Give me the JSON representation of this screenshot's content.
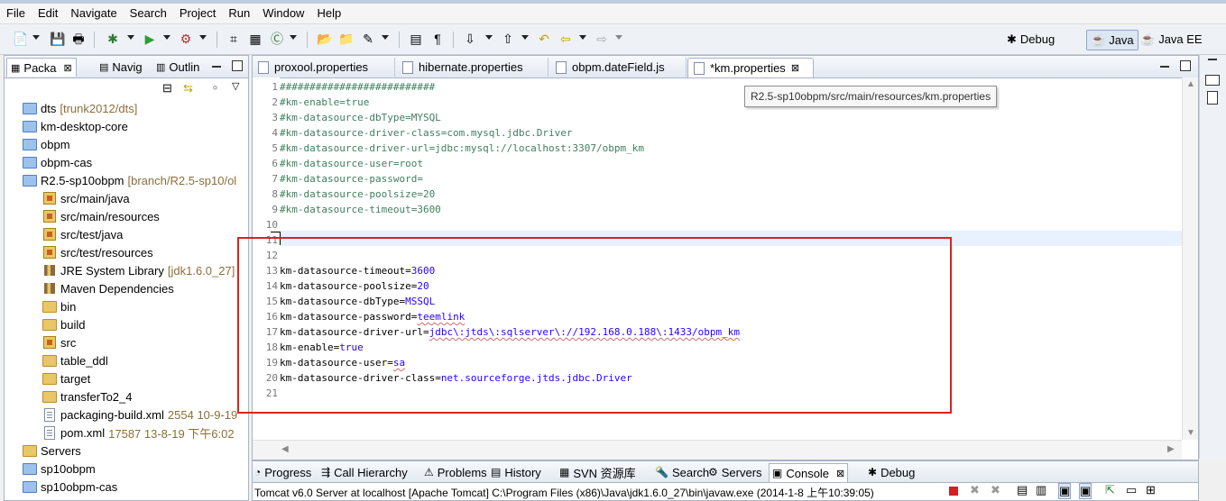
{
  "menu": [
    "File",
    "Edit",
    "Navigate",
    "Search",
    "Project",
    "Run",
    "Window",
    "Help"
  ],
  "perspectives": [
    {
      "label": "Debug",
      "active": false
    },
    {
      "label": "Java",
      "active": true
    },
    {
      "label": "Java EE",
      "active": false
    }
  ],
  "left_panel": {
    "tabs": [
      {
        "label": "Packa",
        "active": true,
        "close": "⊠"
      },
      {
        "label": "Navig",
        "active": false
      },
      {
        "label": "Outlin",
        "active": false
      }
    ],
    "tree": [
      {
        "label": "dts",
        "deco": "[trunk2012/dts]",
        "icon": "folder-blue",
        "indent": 0
      },
      {
        "label": "km-desktop-core",
        "deco": "",
        "icon": "folder-blue",
        "indent": 0
      },
      {
        "label": "obpm",
        "deco": "",
        "icon": "folder-blue",
        "indent": 0
      },
      {
        "label": "obpm-cas",
        "deco": "",
        "icon": "folder-blue",
        "indent": 0
      },
      {
        "label": "R2.5-sp10obpm",
        "deco": "[branch/R2.5-sp10/ol",
        "icon": "folder-blue",
        "indent": 0
      },
      {
        "label": "src/main/java",
        "deco": "",
        "icon": "pkg",
        "indent": 1
      },
      {
        "label": "src/main/resources",
        "deco": "",
        "icon": "pkg",
        "indent": 1
      },
      {
        "label": "src/test/java",
        "deco": "",
        "icon": "pkg",
        "indent": 1
      },
      {
        "label": "src/test/resources",
        "deco": "",
        "icon": "pkg",
        "indent": 1
      },
      {
        "label": "JRE System Library",
        "deco": "[jdk1.6.0_27]",
        "icon": "lib",
        "indent": 1
      },
      {
        "label": "Maven Dependencies",
        "deco": "",
        "icon": "lib",
        "indent": 1
      },
      {
        "label": "bin",
        "deco": "",
        "icon": "folder",
        "indent": 1
      },
      {
        "label": "build",
        "deco": "",
        "icon": "folder",
        "indent": 1
      },
      {
        "label": "src",
        "deco": "",
        "icon": "pkg",
        "indent": 1
      },
      {
        "label": "table_ddl",
        "deco": "",
        "icon": "folder",
        "indent": 1
      },
      {
        "label": "target",
        "deco": "",
        "icon": "folder",
        "indent": 1
      },
      {
        "label": "transferTo2_4",
        "deco": "",
        "icon": "folder",
        "indent": 1
      },
      {
        "label": "packaging-build.xml",
        "deco": "2554  10-9-19",
        "icon": "file",
        "indent": 1
      },
      {
        "label": "pom.xml",
        "deco": "17587  13-8-19 下午6:02",
        "icon": "file",
        "indent": 1
      },
      {
        "label": "Servers",
        "deco": "",
        "icon": "folder",
        "indent": 0
      },
      {
        "label": "sp10obpm",
        "deco": "",
        "icon": "folder-blue",
        "indent": 0
      },
      {
        "label": "sp10obpm-cas",
        "deco": "",
        "icon": "folder-blue",
        "indent": 0
      }
    ]
  },
  "editor": {
    "tabs": [
      {
        "label": "proxool.properties",
        "active": false
      },
      {
        "label": "hibernate.properties",
        "active": false
      },
      {
        "label": "obpm.dateField.js",
        "active": false
      },
      {
        "label": "*km.properties",
        "active": true,
        "close": "⊠"
      }
    ],
    "tooltip": "R2.5-sp10obpm/src/main/resources/km.properties",
    "lines": [
      {
        "n": "1",
        "comment": "##########################"
      },
      {
        "n": "2",
        "comment": "#km-enable=true"
      },
      {
        "n": "3",
        "comment": "#km-datasource-dbType=MYSQL"
      },
      {
        "n": "4",
        "comment": "#km-datasource-driver-class=com.mysql.jdbc.Driver"
      },
      {
        "n": "5",
        "comment": "#km-datasource-driver-url=jdbc:mysql://localhost:3307/obpm_km"
      },
      {
        "n": "6",
        "comment": "#km-datasource-user=root"
      },
      {
        "n": "7",
        "comment": "#km-datasource-password="
      },
      {
        "n": "8",
        "comment": "#km-datasource-poolsize=20"
      },
      {
        "n": "9",
        "comment": "#km-datasource-timeout=3600"
      },
      {
        "n": "10",
        "comment": ""
      },
      {
        "n": "11",
        "comment": ""
      },
      {
        "n": "12",
        "comment": ""
      },
      {
        "n": "13",
        "key": "km-datasource-timeout",
        "value": "3600"
      },
      {
        "n": "14",
        "key": "km-datasource-poolsize",
        "value": "20"
      },
      {
        "n": "15",
        "key": "km-datasource-dbType",
        "value": "MSSQL"
      },
      {
        "n": "16",
        "key": "km-datasource-password",
        "value": "teemlink"
      },
      {
        "n": "17",
        "key": "km-datasource-driver-url",
        "value": "jdbc\\:jtds\\:sqlserver\\://192.168.0.188\\:1433/obpm_km"
      },
      {
        "n": "18",
        "key": "km-enable",
        "value": "true"
      },
      {
        "n": "19",
        "key": "km-datasource-user",
        "value": "sa"
      },
      {
        "n": "20",
        "key": "km-datasource-driver-class",
        "value": "net.sourceforge.jtds.jdbc.Driver"
      },
      {
        "n": "21",
        "comment": ""
      }
    ]
  },
  "bottom": {
    "tabs": [
      {
        "label": "Progress",
        "icon": "◔"
      },
      {
        "label": "Call Hierarchy",
        "icon": "⇶"
      },
      {
        "label": "Problems",
        "icon": "⚠"
      },
      {
        "label": "History",
        "icon": "▤"
      },
      {
        "label": "SVN 资源库",
        "icon": "▦"
      },
      {
        "label": "Search",
        "icon": "🔦"
      },
      {
        "label": "Servers",
        "icon": "⚙"
      },
      {
        "label": "Console",
        "icon": "▣",
        "active": true,
        "close": "⊠"
      },
      {
        "label": "Debug",
        "icon": "✱"
      }
    ],
    "console_text": "Tomcat v6.0 Server at localhost [Apache Tomcat] C:\\Program Files (x86)\\Java\\jdk1.6.0_27\\bin\\javaw.exe (2014-1-8 上午10:39:05)"
  },
  "colors": {
    "comment": "#3f7f5f",
    "value": "#2a00ff",
    "highlight": "#e02020",
    "decoration": "#8b6f3a"
  }
}
